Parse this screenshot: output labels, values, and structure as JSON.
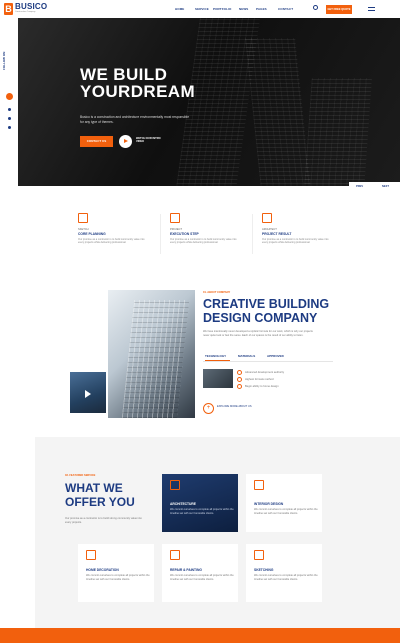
{
  "header": {
    "logo_letter": "B",
    "logo_text": "BUSICO",
    "logo_tagline": "Construction Company",
    "nav": [
      "HOME",
      "SERVICE",
      "PORTFOLIO",
      "NEWS",
      "PAGES",
      "CONTACT"
    ],
    "quote_label": "GET FREE QUOTE"
  },
  "rail": {
    "follow_label": "FOLLOW ON"
  },
  "hero": {
    "title": "WE BUILD YOURDREAM",
    "subtitle": "Busico is a construction and architecture environmentally most responsible for any type of themes.",
    "contact_label": "CONTACT US",
    "video_label": "WATCH OUR INTRO VIDEO",
    "prev_label": "PREV",
    "next_label": "NEXT"
  },
  "features": [
    {
      "category": "SKETCH",
      "title": "CORE PLANNING",
      "desc": "Our promise as a contractor is to build community value into every projects while delivering professional."
    },
    {
      "category": "PROJECT",
      "title": "EXECUTION STEP",
      "desc": "Our promise as a contractor is to build community value into every projects while delivering professional."
    },
    {
      "category": "ARCHITECT",
      "title": "PROJECT RESULT",
      "desc": "Our promise as a contractor is to build community value into every projects while delivering professional."
    }
  ],
  "about": {
    "kicker": "01. ABOUT COMPANY",
    "title": "CREATIVE BUILDING DESIGN COMPANY",
    "desc": "We have intentionally never developed a stylistic formula for our work, which is why our projects never quite look or feel the same. Each of our spaces is the result of our ability to listen.",
    "tabs": [
      "TECHNOLOGY",
      "MATERIALS",
      "APPROVED"
    ],
    "checks": [
      "Advanced development authority",
      "Highest formats method",
      "Begin ability to home design"
    ],
    "more_label": "EXPLORE MORE ABOUT US"
  },
  "services": {
    "kicker": "02. FEATURED SERVICE",
    "title": "WHAT WE OFFER YOU",
    "desc": "Our promise as a contractor is to build strong community value into every projects.",
    "cards": [
      {
        "title": "ARCHITECTURE",
        "desc": "We commit ourselves to complete all projects within the timeline set with our honorable clients."
      },
      {
        "title": "INTERIOR DESIGN",
        "desc": "We commit ourselves to complete all projects within the timeline set with our honorable clients."
      },
      {
        "title": "HOME DECORATION",
        "desc": "We commit ourselves to complete all projects within the timeline set with our honorable clients."
      },
      {
        "title": "REPAIR & PAINTING",
        "desc": "We commit ourselves to complete all projects within the timeline set with our honorable clients."
      },
      {
        "title": "SKETCHING",
        "desc": "We commit ourselves to complete all projects within the timeline set with our honorable clients."
      }
    ]
  },
  "colors": {
    "accent": "#f2600d",
    "brand": "#1d3b82"
  }
}
